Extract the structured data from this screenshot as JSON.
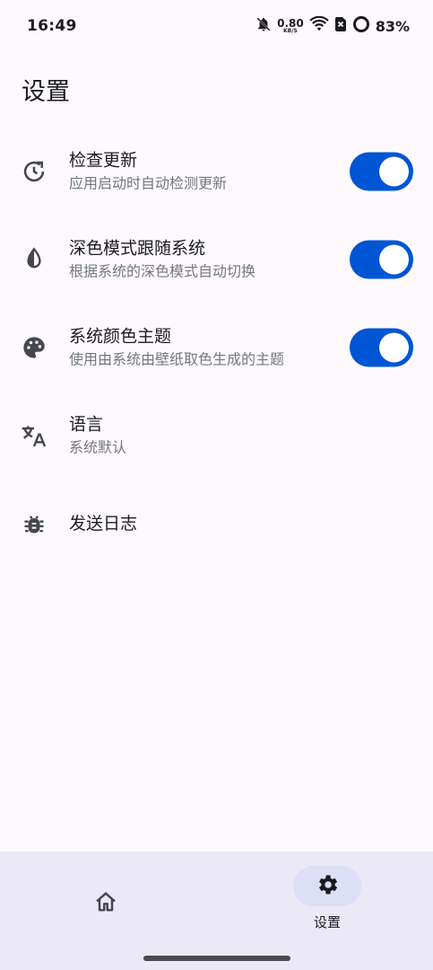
{
  "status_bar": {
    "time": "16:49",
    "net_speed_value": "0.80",
    "net_speed_unit": "KB/S",
    "battery_percent": "83%",
    "icons": [
      "bell-off-icon",
      "wifi-icon",
      "no-sim-icon",
      "battery-ring-icon"
    ]
  },
  "page": {
    "title": "设置"
  },
  "settings": [
    {
      "title": "检查更新",
      "subtitle": "应用启动时自动检测更新",
      "icon": "update-icon",
      "toggle": true
    },
    {
      "title": "深色模式跟随系统",
      "subtitle": "根据系统的深色模式自动切换",
      "icon": "contrast-icon",
      "toggle": true
    },
    {
      "title": "系统颜色主题",
      "subtitle": "使用由系统由壁纸取色生成的主题",
      "icon": "palette-icon",
      "toggle": true
    },
    {
      "title": "语言",
      "subtitle": "系统默认",
      "icon": "translate-icon"
    },
    {
      "title": "发送日志",
      "icon": "bug-icon"
    }
  ],
  "bottom_nav": {
    "items": [
      {
        "label": "",
        "icon": "home-icon",
        "selected": false
      },
      {
        "label": "设置",
        "icon": "gear-icon",
        "selected": true
      }
    ]
  },
  "colors": {
    "accent": "#0055d4",
    "background": "#fdf9fd",
    "nav_background": "#ece9f6",
    "nav_pill": "#dcdff6",
    "subtitle_text": "#74777f"
  }
}
